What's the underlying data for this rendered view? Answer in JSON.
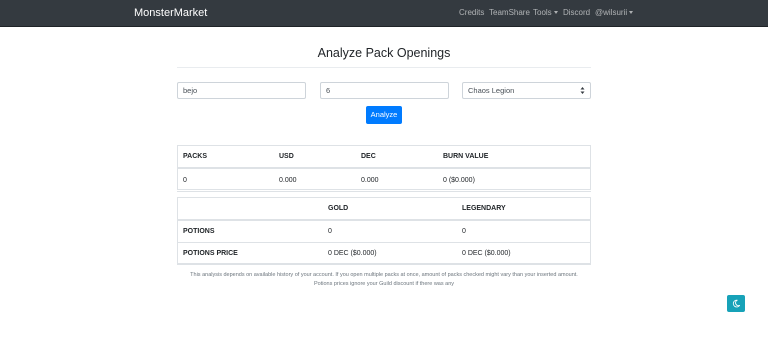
{
  "navbar": {
    "brand": "MonsterMarket",
    "links": [
      "Credits",
      "TeamShare",
      "Tools",
      "Discord",
      "@wilsurii"
    ]
  },
  "page": {
    "title": "Analyze Pack Openings"
  },
  "form": {
    "username": "bejo",
    "edition": "6",
    "set": "Chaos Legion",
    "analyze_label": "Analyze"
  },
  "table1": {
    "headers": [
      "PACKS",
      "USD",
      "DEC",
      "BURN VALUE"
    ],
    "row": [
      "0",
      "0.000",
      "0.000",
      "0 ($0.000)"
    ]
  },
  "table2": {
    "headers": [
      "",
      "GOLD",
      "LEGENDARY"
    ],
    "rows": [
      [
        "POTIONS",
        "0",
        "0"
      ],
      [
        "POTIONS PRICE",
        "0 DEC ($0.000)",
        "0 DEC ($0.000)"
      ]
    ]
  },
  "notes": {
    "line1": "This analysis depends on available history of your account. If you open multiple packs at once, amount of packs checked might vary than your inserted amount.",
    "line2": "Potions prices ignore your Guild discount if there was any"
  },
  "theme_toggle": {
    "icon": "moon-icon"
  }
}
